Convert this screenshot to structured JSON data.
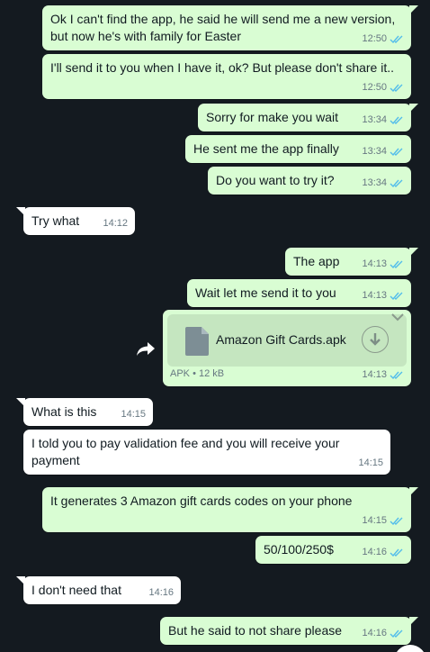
{
  "messages": [
    {
      "id": "m1",
      "direction": "out",
      "text": "Ok I can't find the app, he said he will send me a new version,\nbut now he's with family for Easter",
      "time": "12:50"
    },
    {
      "id": "m2",
      "direction": "out",
      "text": "I'll send it to you when I have it, ok? But please don't share it..",
      "time": "12:50"
    },
    {
      "id": "m3",
      "direction": "out",
      "text": "Sorry for make you wait",
      "time": "13:34"
    },
    {
      "id": "m4",
      "direction": "out",
      "text": "He sent me the app finally",
      "time": "13:34"
    },
    {
      "id": "m5",
      "direction": "out",
      "text": "Do you want to try it?",
      "time": "13:34"
    },
    {
      "id": "m6",
      "direction": "in",
      "text": "Try what",
      "time": "14:12"
    },
    {
      "id": "m7",
      "direction": "out",
      "text": "The app",
      "time": "14:13"
    },
    {
      "id": "m8",
      "direction": "out",
      "text": "Wait let me send it to you",
      "time": "14:13"
    },
    {
      "id": "m10",
      "direction": "in",
      "text": "What is this",
      "time": "14:15"
    },
    {
      "id": "m11",
      "direction": "in",
      "text": "I told you to pay validation fee and you will receive your\npayment",
      "time": "14:15"
    },
    {
      "id": "m12",
      "direction": "out",
      "text": "It generates 3 Amazon gift cards codes on your phone",
      "time": "14:15"
    },
    {
      "id": "m13",
      "direction": "out",
      "text": "50/100/250$",
      "time": "14:16"
    },
    {
      "id": "m14",
      "direction": "in",
      "text": "I don't need that",
      "time": "14:16"
    },
    {
      "id": "m15",
      "direction": "out",
      "text": "But he said to not share please",
      "time": "14:16"
    }
  ],
  "file_message": {
    "file_name": "Amazon Gift Cards.apk",
    "file_type": "APK",
    "separator": "•",
    "file_size": "12 kB",
    "time": "14:13"
  },
  "icons": {
    "read_receipt": "double-check-icon",
    "file": "file-icon",
    "download": "download-icon",
    "forward": "forward-icon",
    "menu": "chevron-down-icon"
  },
  "colors": {
    "background": "#141a20",
    "outgoing_bubble": "#d9fdd3",
    "incoming_bubble": "#ffffff",
    "read_tick": "#53bdeb",
    "meta_text": "#667781"
  }
}
